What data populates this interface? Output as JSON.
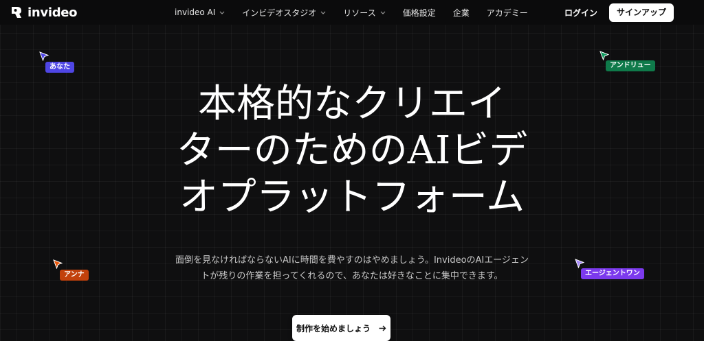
{
  "brand": {
    "name": "invideo"
  },
  "nav": {
    "items": [
      {
        "label": "invideo AI",
        "has_dropdown": true
      },
      {
        "label": "インビデオスタジオ",
        "has_dropdown": true
      },
      {
        "label": "リソース",
        "has_dropdown": true
      },
      {
        "label": "価格設定",
        "has_dropdown": false
      },
      {
        "label": "企業",
        "has_dropdown": false
      },
      {
        "label": "アカデミー",
        "has_dropdown": false
      }
    ],
    "login_label": "ログイン",
    "signup_label": "サインアップ"
  },
  "hero": {
    "headline_lines": [
      "本格的なクリエイ",
      "ターのためのAIビデ",
      "オプラットフォーム"
    ],
    "sub_lines": [
      "面倒を見なければならないAIに時間を費やすのはやめましょう。InvideoのAIエージェン",
      "トが残りの作業を担ってくれるので、あなたは好きなことに集中できます。"
    ],
    "cta_label": "制作を始めましょう",
    "cta_icon": "arrow-right-icon"
  },
  "cursors": [
    {
      "label": "あなた",
      "color": "#4f46e5"
    },
    {
      "label": "アンドリュー",
      "color": "#0f7a4a"
    },
    {
      "label": "アンナ",
      "color": "#c2410c"
    },
    {
      "label": "エージェントワン",
      "color": "#7c3aed"
    }
  ],
  "colors": {
    "background": "#0f0f10",
    "button_bg": "#ffffff",
    "you_tag": "#4f46e5",
    "andrew_tag": "#0f7a4a",
    "anna_tag": "#c2410c",
    "agent_tag": "#7c3aed"
  }
}
